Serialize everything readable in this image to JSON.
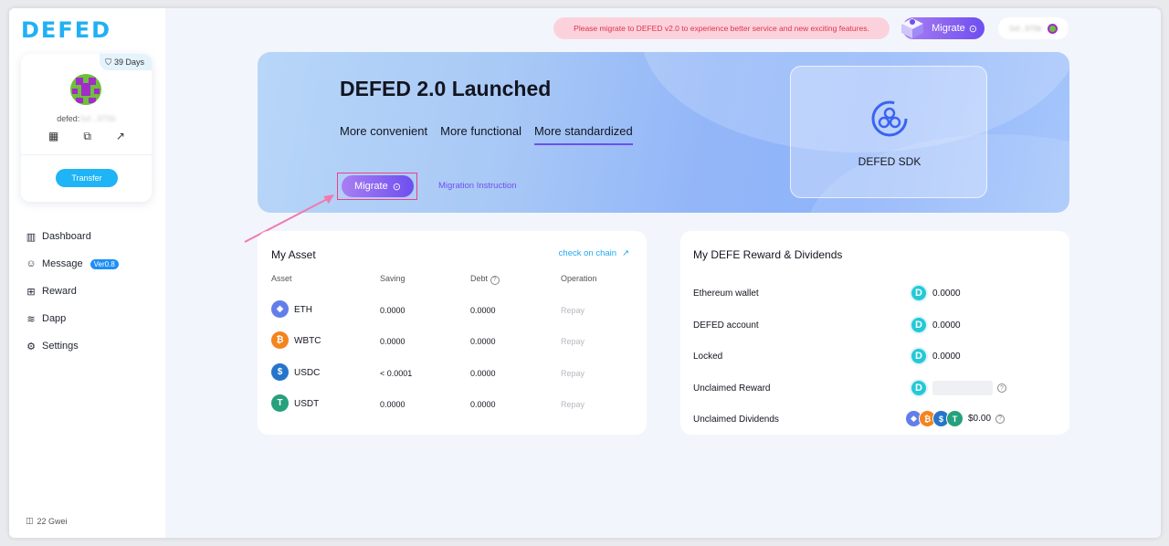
{
  "brand": {
    "logo": "DEFED"
  },
  "profile": {
    "days": "39 Days",
    "addr_prefix": "defed:",
    "addr_hidden": "0xf...970b",
    "transfer": "Transfer"
  },
  "nav": [
    {
      "label": "Dashboard",
      "icon": "dashboard-icon"
    },
    {
      "label": "Message",
      "icon": "message-icon",
      "badge": "Ver0.8"
    },
    {
      "label": "Reward",
      "icon": "gift-icon"
    },
    {
      "label": "Dapp",
      "icon": "layers-icon"
    },
    {
      "label": "Settings",
      "icon": "gear-icon"
    }
  ],
  "footer": {
    "gwei": "22 Gwei"
  },
  "topbar": {
    "notice": "Please migrate to DEFED v2.0 to experience better service and new exciting features.",
    "migrate": "Migrate",
    "address": "0xf...970b"
  },
  "banner": {
    "title": "DEFED 2.0 Launched",
    "tabs": [
      "More convenient",
      "More functional",
      "More standardized"
    ],
    "migrate": "Migrate",
    "instruction": "Migration Instruction",
    "sdk_label": "DEFED SDK"
  },
  "asset": {
    "title": "My Asset",
    "check_chain": "check on chain",
    "headers": {
      "asset": "Asset",
      "saving": "Saving",
      "debt": "Debt",
      "operation": "Operation"
    },
    "rows": [
      {
        "name": "ETH",
        "saving": "0.0000",
        "debt": "0.0000",
        "op": "Repay",
        "color": "#627eea",
        "glyph": "◆"
      },
      {
        "name": "WBTC",
        "saving": "0.0000",
        "debt": "0.0000",
        "op": "Repay",
        "color": "#f4841d",
        "glyph": "₿"
      },
      {
        "name": "USDC",
        "saving": "< 0.0001",
        "debt": "0.0000",
        "op": "Repay",
        "color": "#2775ca",
        "glyph": "$"
      },
      {
        "name": "USDT",
        "saving": "0.0000",
        "debt": "0.0000",
        "op": "Repay",
        "color": "#26a17b",
        "glyph": "T"
      }
    ]
  },
  "reward": {
    "title": "My DEFE Reward & Dividends",
    "rows": [
      {
        "label": "Ethereum wallet",
        "value": "0.0000"
      },
      {
        "label": "DEFED account",
        "value": "0.0000"
      },
      {
        "label": "Locked",
        "value": "0.0000"
      },
      {
        "label": "Unclaimed Reward",
        "value": ""
      },
      {
        "label": "Unclaimed Dividends",
        "value": "$0.00"
      }
    ]
  },
  "colors": {
    "accent": "#6e4fef",
    "brand": "#20b1f4"
  }
}
